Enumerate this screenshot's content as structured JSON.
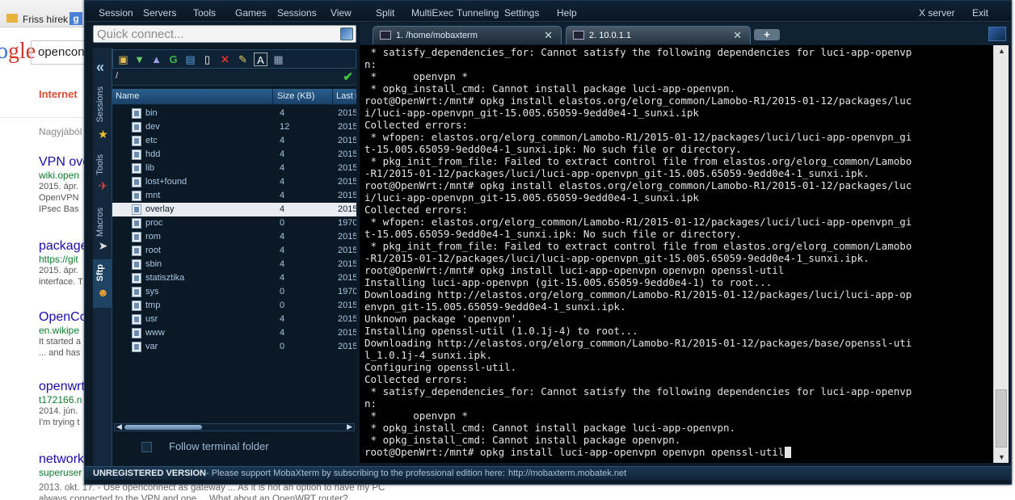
{
  "browser": {
    "bookmark_label": "Friss hírek",
    "logo_left": "o",
    "logo_right": "gle",
    "search_value": "opencon",
    "tab_internet": "Internet",
    "result_count": "Nagyjából",
    "results": [
      {
        "title": "VPN ove",
        "url": "wiki.open",
        "snippet": [
          "2015. ápr.",
          "OpenVPN",
          "IPsec Bas"
        ]
      },
      {
        "title": "package",
        "url": "https://git",
        "snippet": [
          "2015. ápr.",
          "interface. T"
        ]
      },
      {
        "title": "OpenCo",
        "url": "en.wikipe",
        "snippet": [
          "It started a",
          "... and has"
        ]
      },
      {
        "title": "openwrt",
        "url": "t172166.n",
        "snippet": [
          "2014. jún.",
          "I'm trying t"
        ]
      },
      {
        "title": "network",
        "url": "superuser",
        "snippet": []
      }
    ],
    "bottom_line1": "2013. okt. 17. - Use openconnect as gateway ... As it is not an option to have my PC",
    "bottom_line2": "always connected to the VPN and one ... What about an OpenWRT router?"
  },
  "menu": [
    "Session",
    "Servers",
    "Tools",
    "Games",
    "Sessions",
    "View",
    "Split",
    "MultiExec",
    "Tunneling",
    "Settings",
    "Help",
    "X server",
    "Exit"
  ],
  "quick_connect": {
    "placeholder": "Quick connect..."
  },
  "sidebar_tabs": [
    "Sessions",
    "Tools",
    "Macros",
    "Sftp"
  ],
  "sftp": {
    "path": "/",
    "columns": [
      "Name",
      "Size (KB)",
      "Last m"
    ],
    "files": [
      {
        "name": "bin",
        "size": "4",
        "date": "2015"
      },
      {
        "name": "dev",
        "size": "12",
        "date": "2015"
      },
      {
        "name": "etc",
        "size": "4",
        "date": "2015"
      },
      {
        "name": "hdd",
        "size": "4",
        "date": "2015"
      },
      {
        "name": "lib",
        "size": "4",
        "date": "2015"
      },
      {
        "name": "lost+found",
        "size": "4",
        "date": "2015"
      },
      {
        "name": "mnt",
        "size": "4",
        "date": "2015"
      },
      {
        "name": "overlay",
        "size": "4",
        "date": "2015"
      },
      {
        "name": "proc",
        "size": "0",
        "date": "1970"
      },
      {
        "name": "rom",
        "size": "4",
        "date": "2015"
      },
      {
        "name": "root",
        "size": "4",
        "date": "2015"
      },
      {
        "name": "sbin",
        "size": "4",
        "date": "2015"
      },
      {
        "name": "statisztika",
        "size": "4",
        "date": "2015"
      },
      {
        "name": "sys",
        "size": "0",
        "date": "1970"
      },
      {
        "name": "tmp",
        "size": "0",
        "date": "2015"
      },
      {
        "name": "usr",
        "size": "4",
        "date": "2015"
      },
      {
        "name": "www",
        "size": "4",
        "date": "2015"
      },
      {
        "name": "var",
        "size": "0",
        "date": "2015"
      }
    ],
    "selected_index": 7,
    "follow_label": "Follow terminal folder"
  },
  "tabs": [
    {
      "label": "1. /home/mobaxterm"
    },
    {
      "label": "2. 10.0.1.1"
    }
  ],
  "terminal_lines": [
    " * satisfy_dependencies_for: Cannot satisfy the following dependencies for luci-app-openvp",
    "n:",
    " *      openvpn *",
    " * opkg_install_cmd: Cannot install package luci-app-openvpn.",
    "root@OpenWrt:/mnt# opkg install elastos.org/elorg_common/Lamobo-R1/2015-01-12/packages/luc",
    "i/luci-app-openvpn_git-15.005.65059-9edd0e4-1_sunxi.ipk",
    "Collected errors:",
    " * wfopen: elastos.org/elorg_common/Lamobo-R1/2015-01-12/packages/luci/luci-app-openvpn_gi",
    "t-15.005.65059-9edd0e4-1_sunxi.ipk: No such file or directory.",
    " * pkg_init_from_file: Failed to extract control file from elastos.org/elorg_common/Lamobo",
    "-R1/2015-01-12/packages/luci/luci-app-openvpn_git-15.005.65059-9edd0e4-1_sunxi.ipk.",
    "root@OpenWrt:/mnt# opkg install elastos.org/elorg_common/Lamobo-R1/2015-01-12/packages/luc",
    "i/luci-app-openvpn_git-15.005.65059-9edd0e4-1_sunxi.ipk",
    "Collected errors:",
    " * wfopen: elastos.org/elorg_common/Lamobo-R1/2015-01-12/packages/luci/luci-app-openvpn_gi",
    "t-15.005.65059-9edd0e4-1_sunxi.ipk: No such file or directory.",
    " * pkg_init_from_file: Failed to extract control file from elastos.org/elorg_common/Lamobo",
    "-R1/2015-01-12/packages/luci/luci-app-openvpn_git-15.005.65059-9edd0e4-1_sunxi.ipk.",
    "root@OpenWrt:/mnt# opkg install luci-app-openvpn openvpn openssl-util",
    "Installing luci-app-openvpn (git-15.005.65059-9edd0e4-1) to root...",
    "Downloading http://elastos.org/elorg_common/Lamobo-R1/2015-01-12/packages/luci/luci-app-op",
    "envpn_git-15.005.65059-9edd0e4-1_sunxi.ipk.",
    "Unknown package 'openvpn'.",
    "Installing openssl-util (1.0.1j-4) to root...",
    "Downloading http://elastos.org/elorg_common/Lamobo-R1/2015-01-12/packages/base/openssl-uti",
    "l_1.0.1j-4_sunxi.ipk.",
    "Configuring openssl-util.",
    "Collected errors:",
    " * satisfy_dependencies_for: Cannot satisfy the following dependencies for luci-app-openvp",
    "n:",
    " *      openvpn *",
    " * opkg_install_cmd: Cannot install package luci-app-openvpn.",
    " * opkg_install_cmd: Cannot install package openvpn.",
    "root@OpenWrt:/mnt# opkg install luci-app-openvpn openvpn openssl-util"
  ],
  "status": {
    "unregistered": "UNREGISTERED VERSION",
    "message": " -  Please support MobaXterm by subscribing to the professional edition here:",
    "url": "http://mobaxterm.mobatek.net"
  },
  "colors": {
    "accent": "#2a5f8c",
    "terminal_bg": "#000000",
    "terminal_fg": "#e4e4e4"
  }
}
